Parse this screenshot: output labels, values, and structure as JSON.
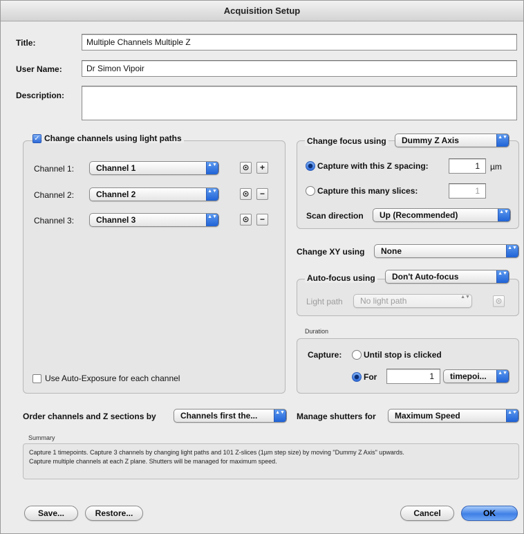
{
  "window": {
    "title": "Acquisition Setup"
  },
  "fields": {
    "title_label": "Title:",
    "title_value": "Multiple Channels Multiple Z",
    "username_label": "User Name:",
    "username_value": "Dr Simon Vipoir",
    "description_label": "Description:",
    "description_value": ""
  },
  "channels": {
    "checkbox_label": "Change channels using light paths",
    "checked": true,
    "rows": [
      {
        "label": "Channel 1:",
        "value": "Channel 1",
        "action": "+"
      },
      {
        "label": "Channel 2:",
        "value": "Channel 2",
        "action": "−"
      },
      {
        "label": "Channel 3:",
        "value": "Channel 3",
        "action": "−"
      }
    ],
    "auto_exposure_label": "Use Auto-Exposure for each channel",
    "auto_exposure_checked": false
  },
  "focus": {
    "label": "Change focus using",
    "value": "Dummy Z Axis",
    "spacing_label": "Capture with this Z spacing:",
    "spacing_value": "1",
    "spacing_unit": "µm",
    "spacing_selected": true,
    "slices_label": "Capture this many slices:",
    "slices_value": "1",
    "scan_label": "Scan direction",
    "scan_value": "Up (Recommended)"
  },
  "xy": {
    "label": "Change XY using",
    "value": "None"
  },
  "autofocus": {
    "label": "Auto-focus using",
    "value": "Don't Auto-focus",
    "lightpath_label": "Light path",
    "lightpath_value": "No light path"
  },
  "duration": {
    "title": "Duration",
    "capture_label": "Capture:",
    "until_label": "Until stop is clicked",
    "for_label": "For",
    "for_value": "1",
    "unit_value": "timepoi...",
    "for_selected": true
  },
  "order": {
    "label": "Order channels and Z sections by",
    "value": "Channels first the..."
  },
  "shutters": {
    "label": "Manage shutters for",
    "value": "Maximum Speed"
  },
  "summary": {
    "title": "Summary",
    "line1": "Capture 1 timepoints.  Capture 3 channels by changing light paths and 101 Z-slices (1µm step size) by moving \"Dummy Z Axis\" upwards.",
    "line2": "Capture multiple channels at each Z plane.  Shutters will be managed for maximum speed."
  },
  "buttons": {
    "save": "Save...",
    "restore": "Restore...",
    "cancel": "Cancel",
    "ok": "OK"
  },
  "icons": {
    "popup_arrows": "▲▼",
    "settings_glyph": "⊙",
    "checkmark": "✓"
  }
}
